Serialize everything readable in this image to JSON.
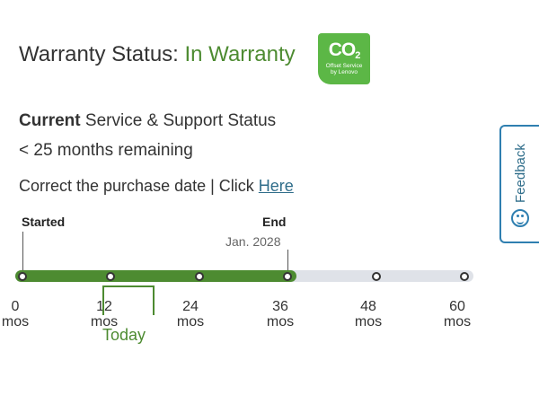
{
  "header": {
    "title_prefix": "Warranty Status: ",
    "status": "In Warranty"
  },
  "co2_badge": {
    "title": "CO",
    "subscript": "2",
    "line1": "Offset Service",
    "line2": "by Lenovo",
    "color": "#5cb746"
  },
  "service": {
    "heading_bold": "Current",
    "heading_rest": " Service & Support Status",
    "remaining": "< 25 months remaining",
    "correct_text": "Correct the purchase date | Click ",
    "correct_link": "Here"
  },
  "timeline": {
    "started_label": "Started",
    "end_label": "End",
    "end_date": "Jan. 2028",
    "progress_fraction": 0.6,
    "fill_color": "#4d8b31",
    "ticks": [
      {
        "value": "0",
        "unit": "mos"
      },
      {
        "value": "12",
        "unit": "mos"
      },
      {
        "value": "24",
        "unit": "mos"
      },
      {
        "value": "36",
        "unit": "mos"
      },
      {
        "value": "48",
        "unit": "mos"
      },
      {
        "value": "60",
        "unit": "mos"
      }
    ],
    "today_label": "Today"
  },
  "feedback": {
    "label": "Feedback",
    "icon": "smiley-icon"
  }
}
